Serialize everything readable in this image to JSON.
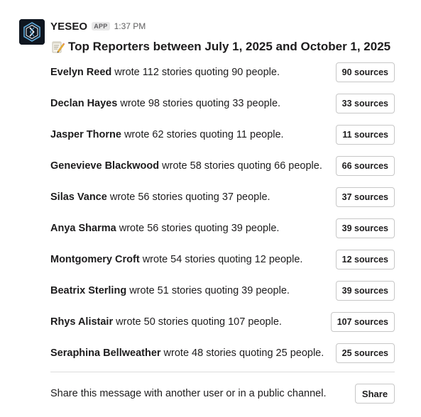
{
  "message": {
    "sender": "YESEO",
    "app_badge": "APP",
    "timestamp": "1:37 PM",
    "title": "Top Reporters between July 1, 2025 and October 1, 2025",
    "title_icon": "memo-icon"
  },
  "reporters": [
    {
      "name": "Evelyn Reed",
      "summary": " wrote 112 stories quoting 90 people.",
      "button": "90 sources"
    },
    {
      "name": "Declan Hayes",
      "summary": " wrote 98 stories quoting 33 people.",
      "button": "33 sources"
    },
    {
      "name": "Jasper Thorne",
      "summary": " wrote 62 stories quoting 11 people.",
      "button": "11 sources"
    },
    {
      "name": "Genevieve Blackwood",
      "summary": " wrote 58 stories quoting 66 people.",
      "button": "66 sources"
    },
    {
      "name": "Silas Vance",
      "summary": " wrote 56 stories quoting 37 people.",
      "button": "37 sources"
    },
    {
      "name": "Anya Sharma",
      "summary": " wrote 56 stories quoting 39 people.",
      "button": "39 sources"
    },
    {
      "name": "Montgomery Croft",
      "summary": " wrote 54 stories quoting 12 people.",
      "button": "12 sources"
    },
    {
      "name": "Beatrix Sterling",
      "summary": " wrote 51 stories quoting 39 people.",
      "button": "39 sources"
    },
    {
      "name": "Rhys Alistair",
      "summary": " wrote 50 stories quoting 107 people.",
      "button": "107 sources"
    },
    {
      "name": "Seraphina Bellweather",
      "summary": " wrote 48 stories quoting 25 people.",
      "button": "25 sources"
    }
  ],
  "share": {
    "text": "Share this message with another user or in a public channel.",
    "button": "Share"
  }
}
